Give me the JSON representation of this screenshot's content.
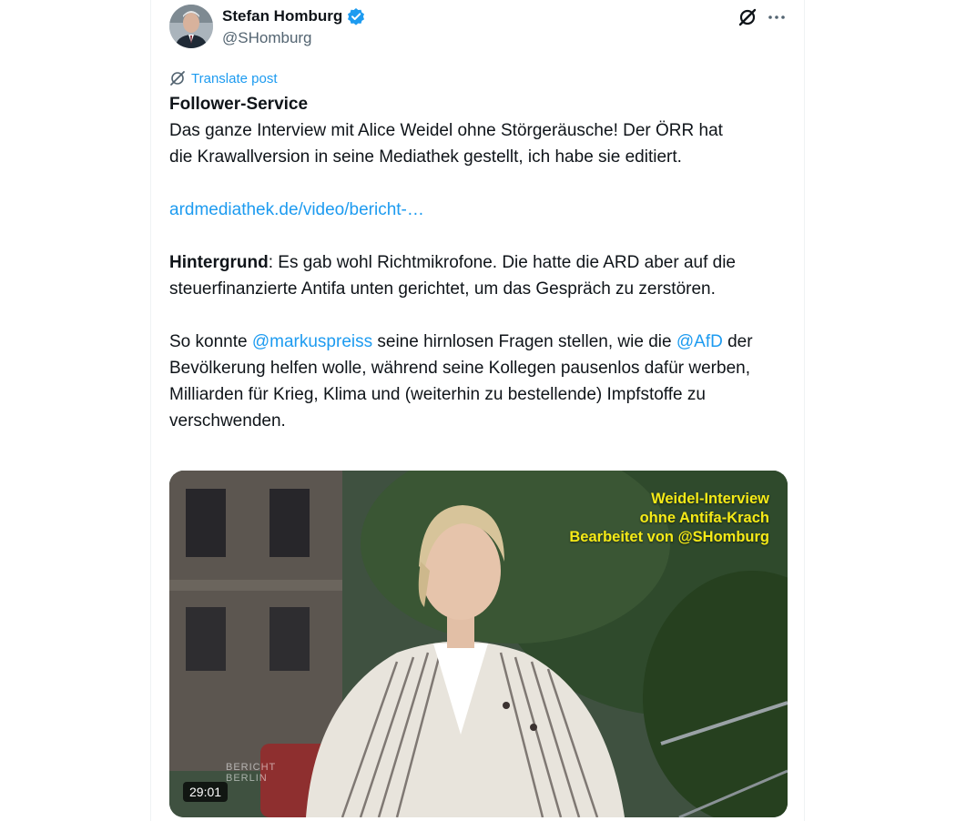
{
  "author": {
    "name": "Stefan Homburg",
    "handle": "@SHomburg",
    "verified": true,
    "avatar_icon": "author-avatar"
  },
  "actions": {
    "grok_icon": "grok-icon",
    "more_icon": "more-dots-icon"
  },
  "translate": {
    "label": "Translate post",
    "icon": "translate-icon"
  },
  "post": {
    "title": "Follower-Service",
    "line1": "Das ganze Interview mit Alice Weidel ohne Störgeräusche! Der ÖRR hat",
    "line2": "die Krawallversion in seine Mediathek gestellt, ich habe sie editiert.",
    "link": "ardmediathek.de/video/bericht-…",
    "background_label": "Hintergrund",
    "background_text": ": Es gab wohl Richtmikrofone. Die hatte die ARD aber auf die steuerfinanzierte Antifa unten gerichtet, um das Gespräch zu zerstören.",
    "p3_start": "So konnte ",
    "mention1": "@markuspreiss",
    "p3_middle": " seine hirnlosen Fragen stellen, wie die ",
    "mention2": "@AfD",
    "p3_end": " der Bevölkerung helfen wolle, während seine Kollegen pausenlos dafür werben, Milliarden für Krieg, Klima und (weiterhin zu bestellende) Impfstoffe zu verschwenden."
  },
  "media": {
    "overlay_line1": "Weidel-Interview",
    "overlay_line2": "ohne Antifa-Krach",
    "overlay_line3": "Bearbeitet von @SHomburg",
    "watermark_line1": "BERICHT",
    "watermark_line2": "BERLIN",
    "duration": "29:01"
  },
  "colors": {
    "link": "#1d9bf0",
    "text": "#0f1419",
    "secondary": "#536471",
    "overlay_yellow": "#f5ea17"
  }
}
